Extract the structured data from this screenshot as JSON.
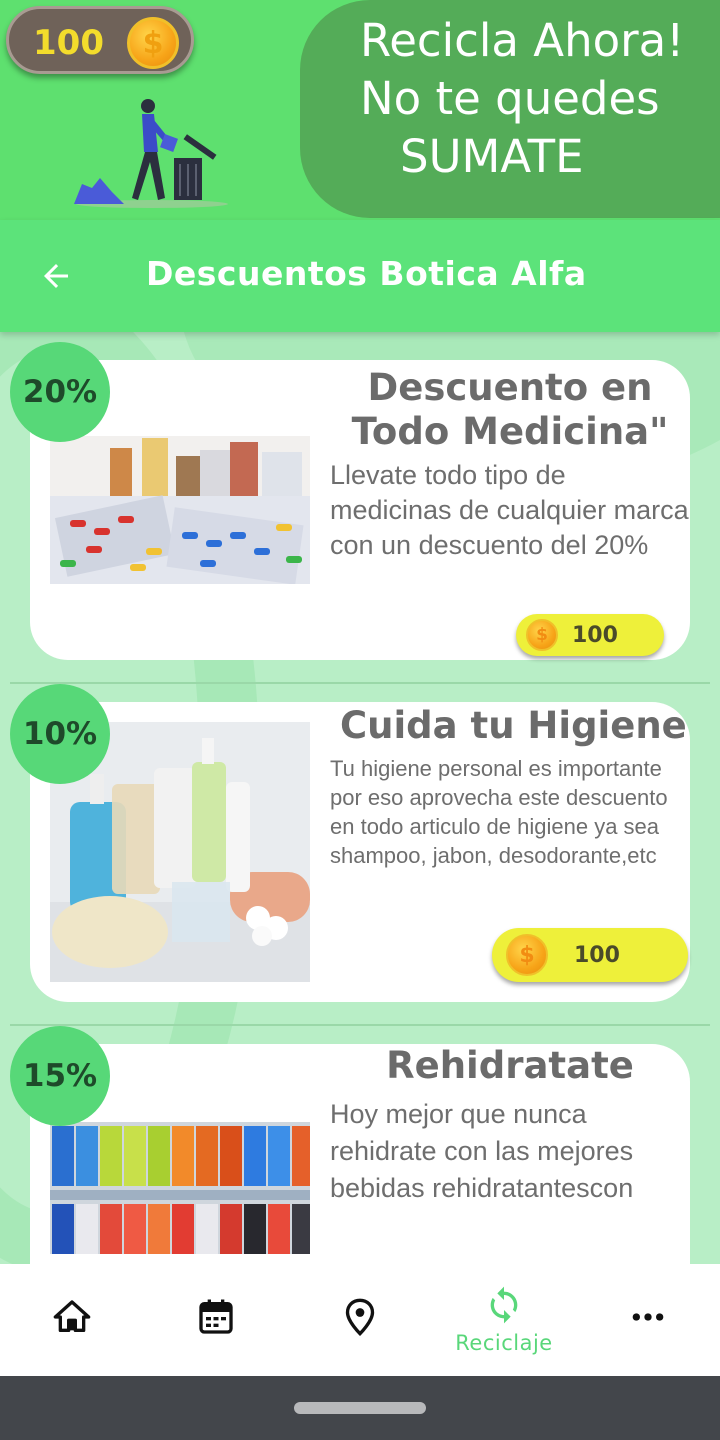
{
  "banner": {
    "coins": "100",
    "coin_icon": "dollar-coin-icon",
    "slogan": [
      "Recicla Ahora!",
      "No te quedes",
      "SUMATE"
    ],
    "colors": {
      "banner_bg": "#5ee06f",
      "slogan_bg": "#54ac58",
      "coin_text": "#f3dc2c"
    }
  },
  "appbar": {
    "back_icon": "arrow-left-icon",
    "title": "Descuentos Botica Alfa",
    "bg_color": "#5ce37a"
  },
  "offers": [
    {
      "discount": "20%",
      "title_lines": [
        "Descuento en",
        "Todo Medicina\""
      ],
      "description": "Llevate todo tipo de medicinas de cualquier marca con un descuento del 20%",
      "price": "100",
      "image": "medicine-pills-photo"
    },
    {
      "discount": "10%",
      "title_lines": [
        "Cuida tu Higiene"
      ],
      "description": "Tu higiene personal es importante por eso aprovecha este descuento en todo articulo de higiene ya sea shampoo, jabon, desodorante,etc",
      "price": "100",
      "image": "hygiene-products-photo"
    },
    {
      "discount": "15%",
      "title_lines": [
        "Rehidratate"
      ],
      "description": "Hoy mejor que nunca rehidrate con las mejores bebidas rehidratantescon",
      "image": "sports-drinks-photo"
    }
  ],
  "bottom_nav": {
    "items": [
      {
        "icon": "home-icon",
        "label": ""
      },
      {
        "icon": "calendar-icon",
        "label": ""
      },
      {
        "icon": "location-pin-icon",
        "label": ""
      },
      {
        "icon": "recycle-icon",
        "label": "Reciclaje",
        "active": true
      },
      {
        "icon": "more-icon",
        "label": ""
      }
    ],
    "active_color": "#59d77a"
  }
}
